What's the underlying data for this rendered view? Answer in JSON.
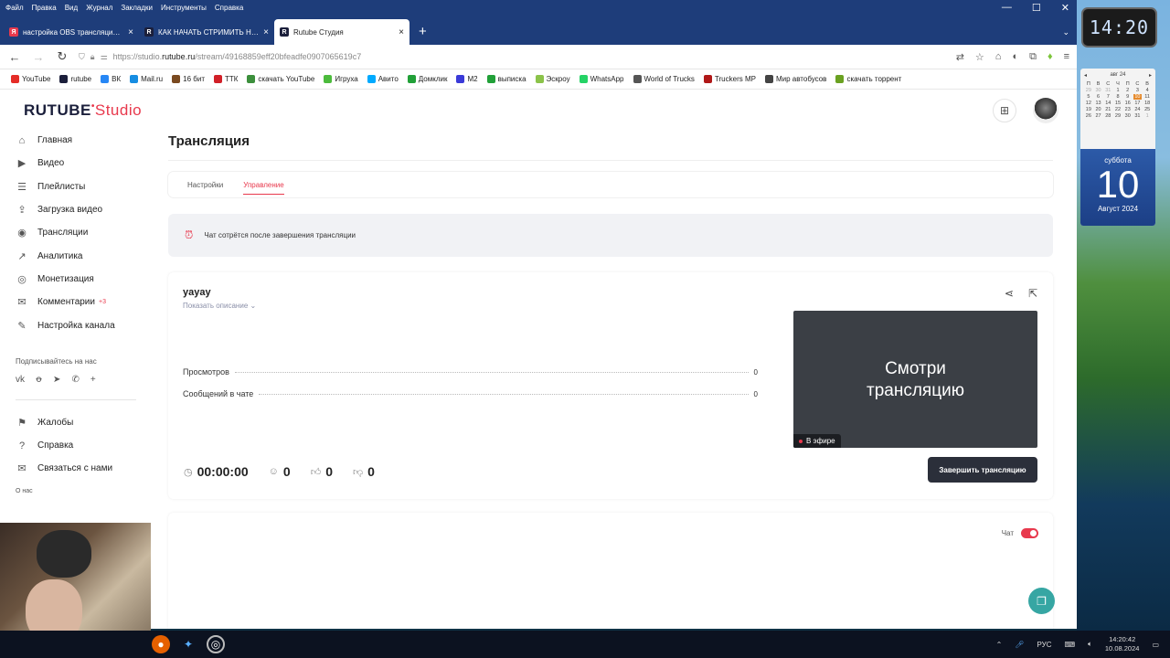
{
  "menu": [
    "Файл",
    "Правка",
    "Вид",
    "Журнал",
    "Закладки",
    "Инструменты",
    "Справка"
  ],
  "tabs": [
    {
      "title": "настройка OBS трансляции на",
      "icon": "yandex-icon",
      "color": "#e8394d",
      "glyph": "Я"
    },
    {
      "title": "КАК НАЧАТЬ СТРИМИТЬ НА Р",
      "icon": "rutube-icon",
      "color": "#1b1f3b",
      "glyph": "R"
    },
    {
      "title": "Rutube Студия",
      "icon": "rutube-icon",
      "color": "#1b1f3b",
      "glyph": "R"
    }
  ],
  "url": {
    "prefix": "https://studio.",
    "domain": "rutube.ru",
    "path": "/stream/49168859eff20bfeadfe0907065619c7"
  },
  "bookmarks": [
    {
      "label": "YouTube",
      "color": "#e52d27"
    },
    {
      "label": "rutube",
      "color": "#1b1f3b"
    },
    {
      "label": "ВК",
      "color": "#2787f5"
    },
    {
      "label": "Mail.ru",
      "color": "#168de2"
    },
    {
      "label": "16 бит",
      "color": "#7a4a20"
    },
    {
      "label": "ТТК",
      "color": "#d12028"
    },
    {
      "label": "скачать YouTube",
      "color": "#3c8f3c"
    },
    {
      "label": "Игруха",
      "color": "#4cbb3c"
    },
    {
      "label": "Авито",
      "color": "#00aaff"
    },
    {
      "label": "Домклик",
      "color": "#21a038"
    },
    {
      "label": "M2",
      "color": "#3a3ad8"
    },
    {
      "label": "выписка",
      "color": "#21a038"
    },
    {
      "label": "Эскроу",
      "color": "#8bc34a"
    },
    {
      "label": "WhatsApp",
      "color": "#25d366"
    },
    {
      "label": "World of Trucks",
      "color": "#555555"
    },
    {
      "label": "Truckers MP",
      "color": "#b01818"
    },
    {
      "label": "Мир автобусов",
      "color": "#444444"
    },
    {
      "label": "скачать торрент",
      "color": "#6aa121"
    }
  ],
  "app": {
    "logo_main": "RUTUBE",
    "logo_studio": "Studio"
  },
  "sidebar": {
    "items": [
      {
        "label": "Главная",
        "icon": "home-icon",
        "glyph": "⌂"
      },
      {
        "label": "Видео",
        "icon": "video-icon",
        "glyph": "▶"
      },
      {
        "label": "Плейлисты",
        "icon": "playlist-icon",
        "glyph": "☰"
      },
      {
        "label": "Загрузка видео",
        "icon": "upload-icon",
        "glyph": "⇪"
      },
      {
        "label": "Трансляции",
        "icon": "broadcast-icon",
        "glyph": "◉"
      },
      {
        "label": "Аналитика",
        "icon": "analytics-icon",
        "glyph": "↗"
      },
      {
        "label": "Монетизация",
        "icon": "monetization-icon",
        "glyph": "◎"
      },
      {
        "label": "Комментарии",
        "icon": "comments-icon",
        "glyph": "✉",
        "badge": "+3"
      },
      {
        "label": "Настройка канала",
        "icon": "channel-settings-icon",
        "glyph": "✎"
      }
    ],
    "subscribe_label": "Подписывайтесь на нас",
    "socials": [
      "vk-icon",
      "ok-icon",
      "telegram-icon",
      "viber-icon",
      "plus-icon"
    ],
    "bottom_items": [
      {
        "label": "Жалобы",
        "icon": "flag-icon",
        "glyph": "⚑"
      },
      {
        "label": "Справка",
        "icon": "help-icon",
        "glyph": "?"
      },
      {
        "label": "Связаться с нами",
        "icon": "contact-icon",
        "glyph": "✉"
      }
    ],
    "about": "О нас"
  },
  "page": {
    "title": "Трансляция",
    "tabs": [
      {
        "label": "Настройки"
      },
      {
        "label": "Управление",
        "active": true
      }
    ],
    "notice": "Чат сотрётся после завершения трансляции"
  },
  "stream": {
    "name": "yayay",
    "show_description": "Показать описание",
    "stats": [
      {
        "label": "Просмотров",
        "value": "0"
      },
      {
        "label": "Сообщений в чате",
        "value": "0"
      }
    ],
    "duration": "00:00:00",
    "viewers": "0",
    "likes": "0",
    "dislikes": "0",
    "preview_text_1": "Смотри",
    "preview_text_2": "трансляцию",
    "live_label": "В эфире",
    "end_button": "Завершить трансляцию"
  },
  "chat": {
    "label": "Чат",
    "enabled": true
  },
  "gadgets": {
    "clock": "14:20",
    "calendar_month": "авг 24",
    "weekday_headers": [
      "П",
      "В",
      "С",
      "Ч",
      "П",
      "С",
      "В"
    ],
    "calendar_days": [
      "29",
      "30",
      "31",
      "1",
      "2",
      "3",
      "4",
      "5",
      "6",
      "7",
      "8",
      "9",
      "10",
      "11",
      "12",
      "13",
      "14",
      "15",
      "16",
      "17",
      "18",
      "19",
      "20",
      "21",
      "22",
      "23",
      "24",
      "25",
      "26",
      "27",
      "28",
      "29",
      "30",
      "31",
      "1"
    ],
    "today_day": "10",
    "day_of_week": "суббота",
    "month_year": "Август 2024"
  },
  "taskbar": {
    "lang": "РУС",
    "time": "14:20:42",
    "date": "10.08.2024"
  }
}
